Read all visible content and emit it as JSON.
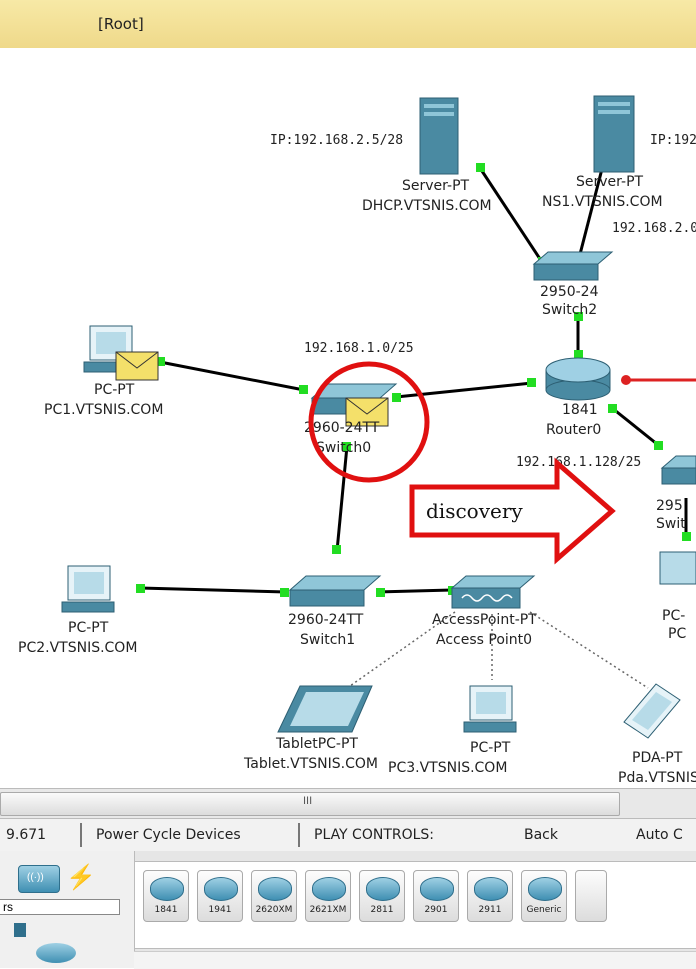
{
  "topbar": {
    "title": "[Root]"
  },
  "network": {
    "ip_server_dhcp": "IP:192.168.2.5/28",
    "ip_server_ns1": "IP:192",
    "subnet_switch0": "192.168.1.0/25",
    "subnet_router_right": "192.168.2.0",
    "subnet_router_below": "192.168.1.128/25",
    "annotation_discovery": "discovery",
    "devices": {
      "dhcp_server": {
        "type": "Server-PT",
        "name": "DHCP.VTSNIS.COM"
      },
      "ns1_server": {
        "type": "Server-PT",
        "name": "NS1.VTSNIS.COM"
      },
      "switch2": {
        "type": "2950-24",
        "name": "Switch2"
      },
      "router0": {
        "type": "1841",
        "name": "Router0"
      },
      "pc1": {
        "type": "PC-PT",
        "name": "PC1.VTSNIS.COM"
      },
      "switch0": {
        "type": "2960-24TT",
        "name": "Switch0"
      },
      "switch_right": {
        "type": "295",
        "name": "Swit"
      },
      "pc_right": {
        "type": "PC-",
        "name": "PC"
      },
      "pc2": {
        "type": "PC-PT",
        "name": "PC2.VTSNIS.COM"
      },
      "switch1": {
        "type": "2960-24TT",
        "name": "Switch1"
      },
      "access_point": {
        "type": "AccessPoint-PT",
        "name": "Access Point0"
      },
      "tablet": {
        "type": "TabletPC-PT",
        "name": "Tablet.VTSNIS.COM"
      },
      "pc3": {
        "type": "PC-PT",
        "name": "PC3.VTSNIS.COM"
      },
      "pda": {
        "type": "PDA-PT",
        "name": "Pda.VTSNIS"
      }
    }
  },
  "scrollbar": {
    "grip": "III"
  },
  "status": {
    "time": "9.671",
    "power_cycle": "Power Cycle Devices",
    "play_controls": "PLAY CONTROLS:",
    "back": "Back",
    "auto": "Auto C"
  },
  "device_panel": {
    "category_label": "rs",
    "routers": [
      "1841",
      "1941",
      "2620XM",
      "2621XM",
      "2811",
      "2901",
      "2911",
      "Generic"
    ]
  },
  "colors": {
    "link": "#000000",
    "port_up": "#22cc22",
    "port_down": "#dd2222",
    "callout": "#e01010"
  }
}
